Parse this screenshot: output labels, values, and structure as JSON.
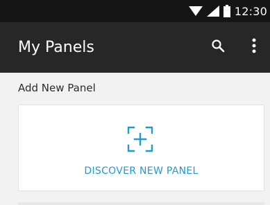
{
  "status_bar": {
    "time": "12:30",
    "icons": [
      "wifi-icon",
      "signal-icon",
      "battery-icon"
    ]
  },
  "app_bar": {
    "title": "My Panels",
    "actions": [
      "search-icon",
      "more-vert-icon"
    ]
  },
  "content": {
    "section_label": "Add New Panel",
    "discover_card": {
      "label": "DISCOVER NEW PANEL",
      "icon": "scan-add-icon"
    }
  },
  "colors": {
    "status_bar_bg": "#151515",
    "app_bar_bg": "#272727",
    "page_bg": "#f2f2f2",
    "accent": "#1e9ad6"
  }
}
